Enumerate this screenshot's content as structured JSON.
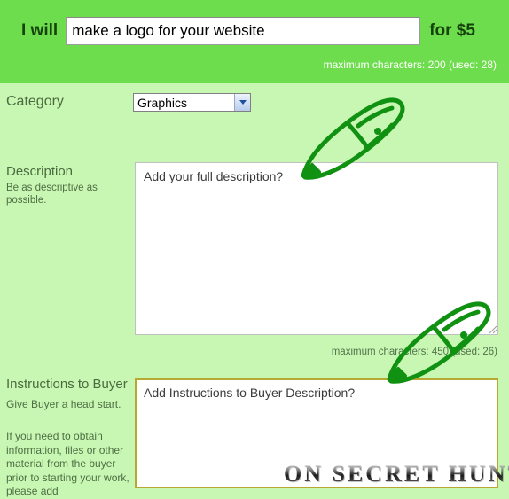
{
  "header": {
    "i_will_label": "I will",
    "title_value": "make a logo for your website",
    "title_placeholder": "",
    "for_price_label": "for $5",
    "title_counter": "maximum characters: 200 (used: 28)"
  },
  "category": {
    "label": "Category",
    "selected": "Graphics",
    "options": [
      "Graphics"
    ],
    "arrow_icon": "chevron-down-icon"
  },
  "description": {
    "label": "Description",
    "hint": "Be as descriptive as possible.",
    "value": "Add your full description?",
    "placeholder": "Add your full description?",
    "counter": "maximum characters: 450 (used: 26)",
    "resize_grip_icon": "resize-grip-icon"
  },
  "instructions": {
    "label": "Instructions to Buyer",
    "hint_line1": "Give Buyer a head start.",
    "hint_line2": "If you need to obtain information, files or other material from the buyer prior to starting your work, please add",
    "value": "Add Instructions to Buyer Description?",
    "placeholder": "Add Instructions to Buyer Description?"
  },
  "annotations": {
    "pen_description": "pen-icon",
    "pen_instructions": "pen-icon"
  },
  "watermark": {
    "text": "ON SECRET HUNT"
  },
  "colors": {
    "header_green": "#6edd4d",
    "body_green": "#c8f7b4",
    "label_green": "#4a6b40",
    "dark_green_text": "#16420b",
    "annotation_green": "#1a8a1a",
    "focus_border_gold": "#b8a832"
  }
}
